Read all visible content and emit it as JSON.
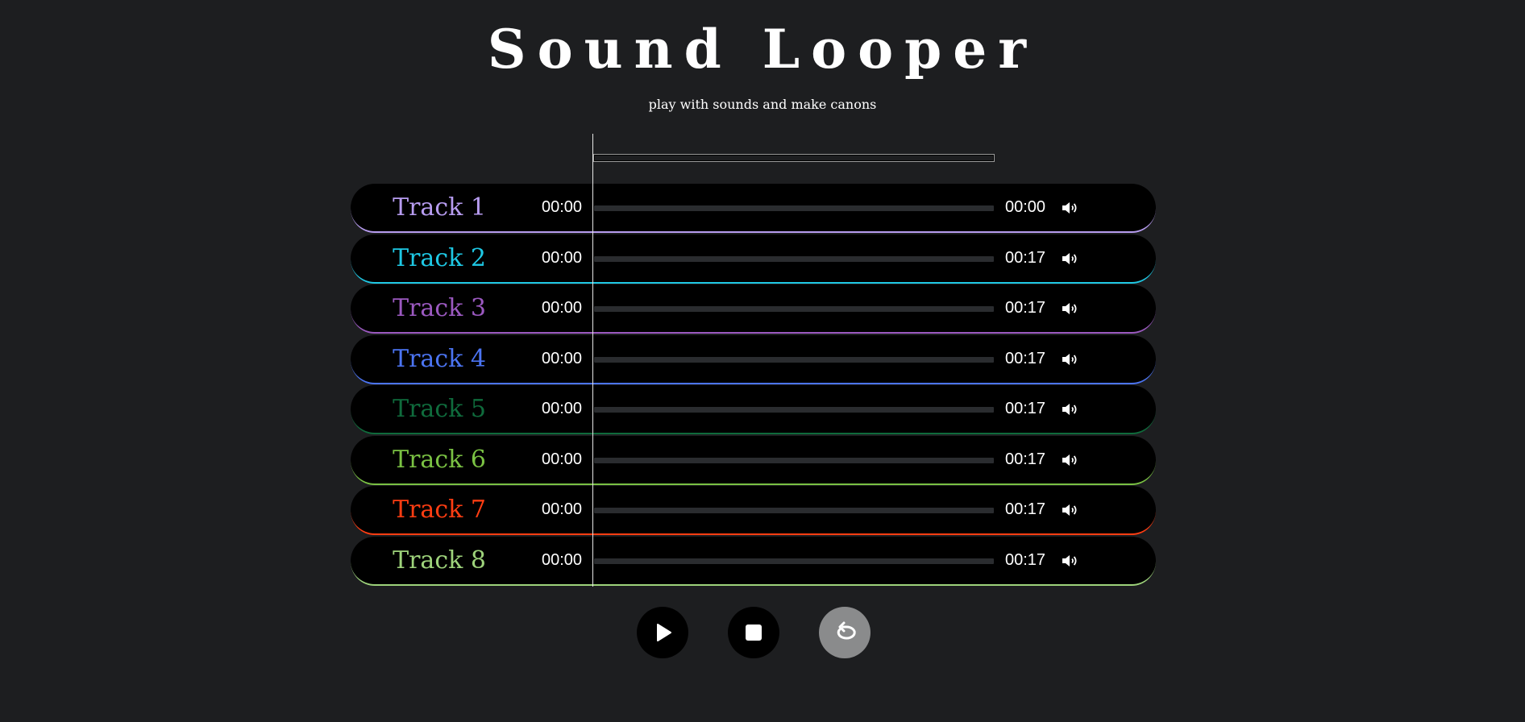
{
  "app": {
    "title": "Sound Looper",
    "subtitle": "play with sounds and make canons"
  },
  "tracks": [
    {
      "name": "Track 1",
      "start_time": "00:00",
      "end_time": "00:00",
      "color": "#b79cf0",
      "icon": "volume-icon"
    },
    {
      "name": "Track 2",
      "start_time": "00:00",
      "end_time": "00:17",
      "color": "#1ec8e4",
      "icon": "volume-icon"
    },
    {
      "name": "Track 3",
      "start_time": "00:00",
      "end_time": "00:17",
      "color": "#9b59c0",
      "icon": "volume-icon"
    },
    {
      "name": "Track 4",
      "start_time": "00:00",
      "end_time": "00:17",
      "color": "#4b74f2",
      "icon": "volume-icon"
    },
    {
      "name": "Track 5",
      "start_time": "00:00",
      "end_time": "00:17",
      "color": "#0f6b3c",
      "icon": "volume-icon"
    },
    {
      "name": "Track 6",
      "start_time": "00:00",
      "end_time": "00:17",
      "color": "#7ac143",
      "icon": "volume-icon"
    },
    {
      "name": "Track 7",
      "start_time": "00:00",
      "end_time": "00:17",
      "color": "#ff3d12",
      "icon": "volume-icon"
    },
    {
      "name": "Track 8",
      "start_time": "00:00",
      "end_time": "00:17",
      "color": "#9ed37b",
      "icon": "volume-icon"
    }
  ],
  "controls": {
    "play_icon": "play-icon",
    "stop_icon": "stop-icon",
    "loop_icon": "loop-icon",
    "loop_background": "#8a8b8c"
  }
}
